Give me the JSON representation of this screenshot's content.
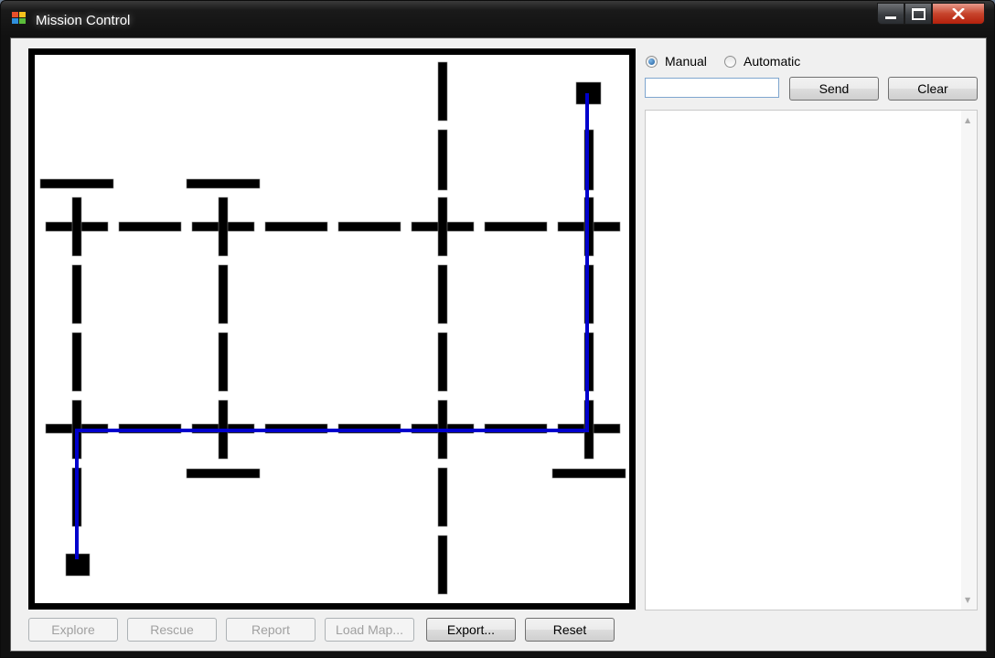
{
  "window": {
    "title": "Mission Control"
  },
  "mode": {
    "manual_label": "Manual",
    "automatic_label": "Automatic",
    "selected": "manual"
  },
  "command": {
    "value": "",
    "send_label": "Send",
    "clear_label": "Clear"
  },
  "log": {
    "text": ""
  },
  "buttons": {
    "explore": "Explore",
    "rescue": "Rescue",
    "report": "Report",
    "load_map": "Load Map...",
    "export": "Export...",
    "reset": "Reset"
  },
  "colors": {
    "path": "#0000cc",
    "walls": "#000000",
    "close": "#c7442c"
  },
  "icons": {
    "app": "app-icon",
    "minimize": "minimize-icon",
    "maximize": "maximize-icon",
    "close": "close-icon"
  }
}
